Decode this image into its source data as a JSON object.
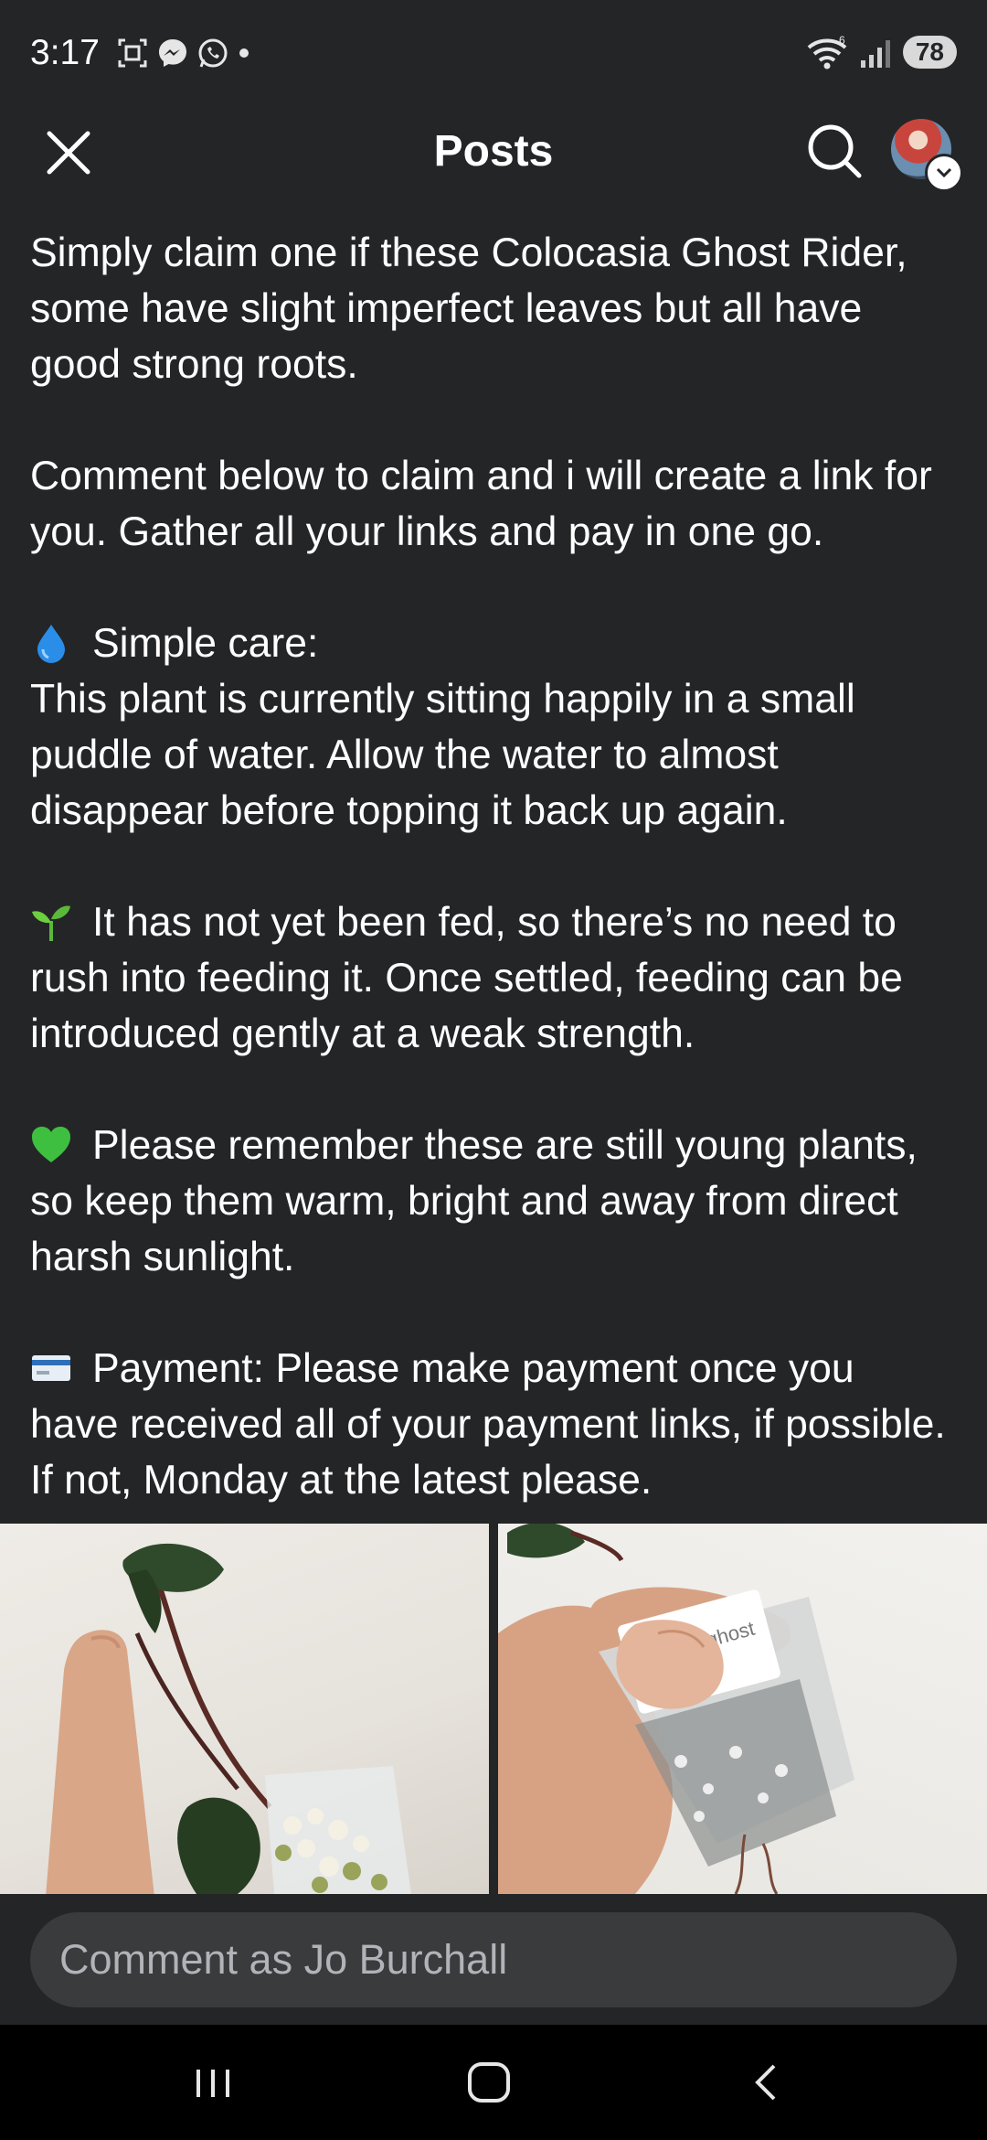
{
  "status_bar": {
    "time": "3:17",
    "notification_icons": [
      "screenshot-icon",
      "messenger-icon",
      "whatsapp-icon",
      "dot-icon"
    ],
    "wifi_label": "6",
    "battery": "78"
  },
  "header": {
    "title": "Posts",
    "close_icon": "close-icon",
    "search_icon": "search-icon"
  },
  "post": {
    "paragraphs": [
      {
        "id": "p1",
        "text": "Simply claim one if these Colocasia Ghost Rider, some have slight imperfect leaves but all have good strong roots."
      },
      {
        "id": "p2",
        "text": "Comment below to claim and i will create a link for you. Gather all your links and pay in one go."
      },
      {
        "id": "p3",
        "emoji": "droplet-emoji",
        "heading": "Simple care:",
        "text": "This plant is currently sitting happily in a small puddle of water. Allow the water to almost disappear before topping it back up again."
      },
      {
        "id": "p4",
        "emoji": "seedling-emoji",
        "text": "It has not yet been fed, so there’s no need to rush into feeding it. Once settled, feeding can be introduced gently at a weak strength."
      },
      {
        "id": "p5",
        "emoji": "green-heart-emoji",
        "text": "Please remember these are still young plants, so keep them warm, bright and away from direct harsh sunlight."
      },
      {
        "id": "p6",
        "emoji": "credit-card-emoji",
        "text": "Payment: Please make payment once you have received all of your payment links, if possible. If not, Monday at the latest please."
      }
    ],
    "photo_label": "ghost"
  },
  "comment": {
    "placeholder": "Comment as Jo Burchall"
  },
  "nav": {
    "buttons": [
      "recent-apps-icon",
      "home-icon",
      "back-icon"
    ]
  },
  "colors": {
    "background": "#242527",
    "input_bg": "#3a3b3c",
    "text": "#ffffff",
    "muted": "#b0b3b8"
  }
}
